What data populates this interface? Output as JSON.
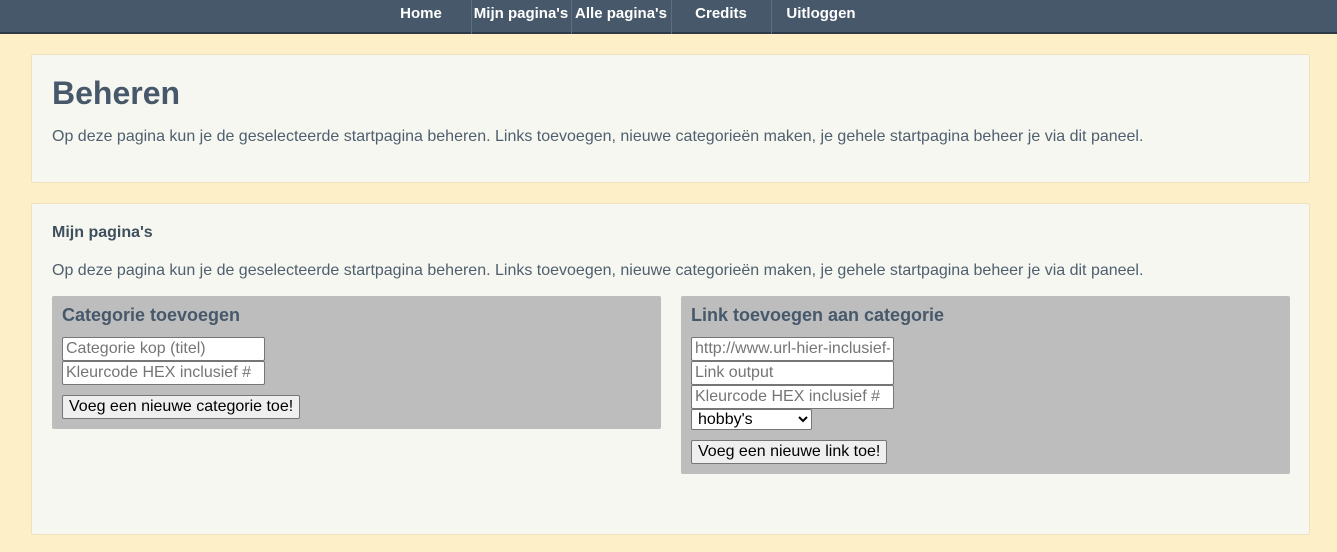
{
  "nav": {
    "items": [
      {
        "label": "Home"
      },
      {
        "label": "Mijn pagina's"
      },
      {
        "label": "Alle pagina's"
      },
      {
        "label": "Credits"
      },
      {
        "label": "Uitloggen"
      }
    ]
  },
  "header": {
    "title": "Beheren",
    "description": "Op deze pagina kun je de geselecteerde startpagina beheren. Links toevoegen, nieuwe categorieën maken, je gehele startpagina beheer je via dit paneel."
  },
  "mijn_paginas": {
    "title": "Mijn pagina's",
    "description": "Op deze pagina kun je de geselecteerde startpagina beheren. Links toevoegen, nieuwe categorieën maken, je gehele startpagina beheer je via dit paneel."
  },
  "category_form": {
    "title": "Categorie toevoegen",
    "title_placeholder": "Categorie kop (titel)",
    "color_placeholder": "Kleurcode HEX inclusief #",
    "submit_label": "Voeg een nieuwe categorie toe!"
  },
  "link_form": {
    "title": "Link toevoegen aan categorie",
    "url_placeholder": "http://www.url-hier-inclusief-http.nl",
    "output_placeholder": "Link output",
    "color_placeholder": "Kleurcode HEX inclusief #",
    "category_selected": "hobby's",
    "submit_label": "Voeg een nieuwe link toe!"
  }
}
